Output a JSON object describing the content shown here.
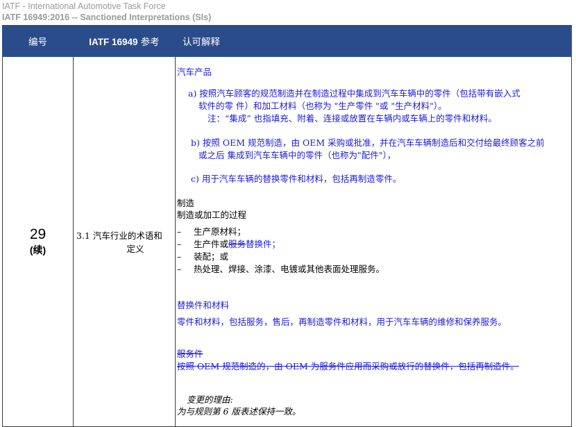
{
  "header": {
    "org": "IATF - International Automotive Task Force",
    "doc": "IATF 16949:2016 -- Sanctioned Interpretations (SIs)"
  },
  "table": {
    "col1": "编号",
    "col2_bold": "IATF 16949",
    "col2_rest": " 参考",
    "col3": "认可解释",
    "row": {
      "number": "29",
      "number_sub": "(续)",
      "reference_line1": "3.1 汽车行业的术语和",
      "reference_line2": "定义"
    }
  },
  "content": {
    "s1_title": "汽车产品",
    "a_line1": "a) 按照汽车顾客的规范制造并在制造过程中集成到汽车车辆中的零件（包括带有嵌入式",
    "a_line2": "软件的零 件）和加工材料（也称为 \"生产零件 \"或 \"生产材料\"）。",
    "a_note": "注：“集成” 也指填充、附着、连接或放置在车辆内或车辆上的零件和材料。",
    "b_line1": "b) 按照 OEM 规范制造，由 OEM 采购或批准，并在汽车车辆制造后和交付给最终顾客之前",
    "b_line2": "或之后 集成到汽车车辆中的零件（也称为\"配件\"），",
    "c_line": "c) 用于汽车车辆的替换零件和材料，包括再制造零件。",
    "s2_title": "制造",
    "s2_sub": "制造或加工的过程",
    "list_dash": "–",
    "li1": "生产原材料；",
    "li2_a": "生产件或",
    "li2_strike": "服务",
    "li2_blue": "替换件；",
    "li3": "装配；或",
    "li4": "热处理、焊接、涂漆、电镀或其他表面处理服务。",
    "s3_title": "替换件和材料",
    "s3_text": "零件和材料，包括服务，售后，再制造零件和材料，用于汽车车辆的维修和保养服务。",
    "s4_title": "服务件",
    "s4_text": "按照 OEM 规范制造的，由 OEM 为服务件应用而采购或放行的替换件，包括再制造件。",
    "reason_title": "变更的理由:",
    "reason_text": "为与规则第 6 版表述保持一致。"
  }
}
